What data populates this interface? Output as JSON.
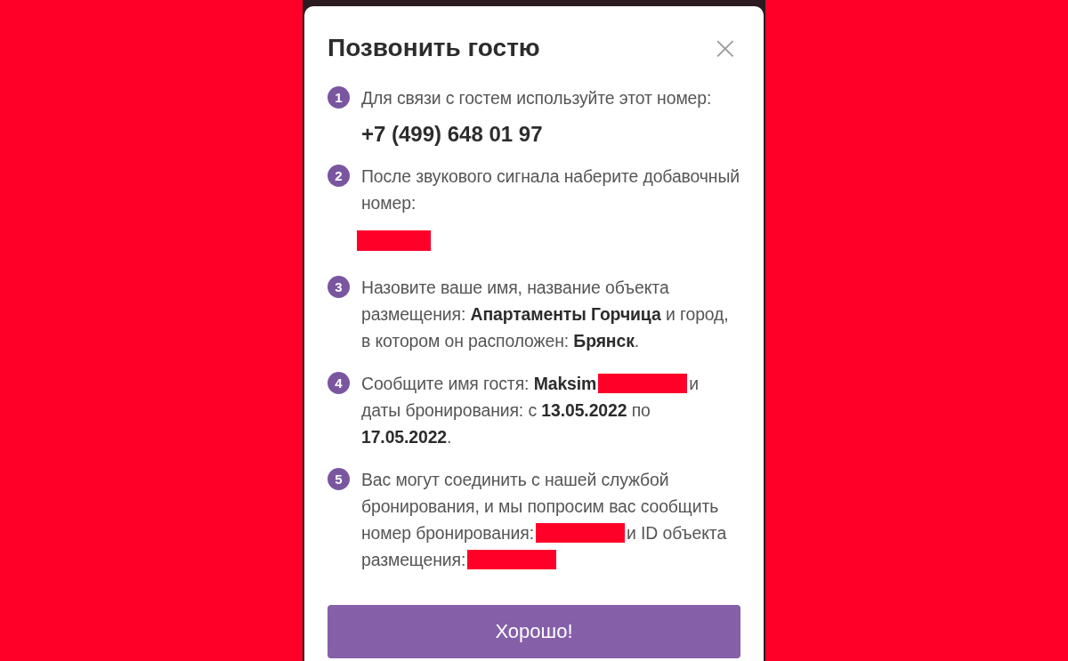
{
  "dialog": {
    "title": "Позвонить гостю",
    "close": "×",
    "steps": [
      {
        "number": "1",
        "segments": [
          {
            "kind": "text",
            "text": "Для связи с гостем используйте этот номер:"
          }
        ],
        "phone": "+7 (499) 648 01 97"
      },
      {
        "number": "2",
        "segments": [
          {
            "kind": "text",
            "text": "После звукового сигнала наберите добавочный номер:"
          },
          {
            "kind": "redacted_block"
          }
        ]
      },
      {
        "number": "3",
        "segments": [
          {
            "kind": "text",
            "text": "Назовите ваше имя, название объекта размещения: **Апартаменты Горчица** и город, в котором он расположен: **Брянск**."
          }
        ]
      },
      {
        "number": "4",
        "segments": [
          {
            "kind": "text",
            "text": "Сообщите имя гостя: **Maksim**"
          },
          {
            "kind": "redacted"
          },
          {
            "kind": "text",
            "text": "и даты бронирования: с **13.05.2022** по **17.05.2022**."
          }
        ]
      },
      {
        "number": "5",
        "segments": [
          {
            "kind": "text",
            "text": "Вас могут соединить с нашей службой бронирования, и мы попросим вас сообщить номер бронирования:"
          },
          {
            "kind": "redacted"
          },
          {
            "kind": "text",
            "text": "и ID объекта размещения:"
          },
          {
            "kind": "redacted"
          }
        ]
      }
    ],
    "button": "Хорошо!"
  }
}
